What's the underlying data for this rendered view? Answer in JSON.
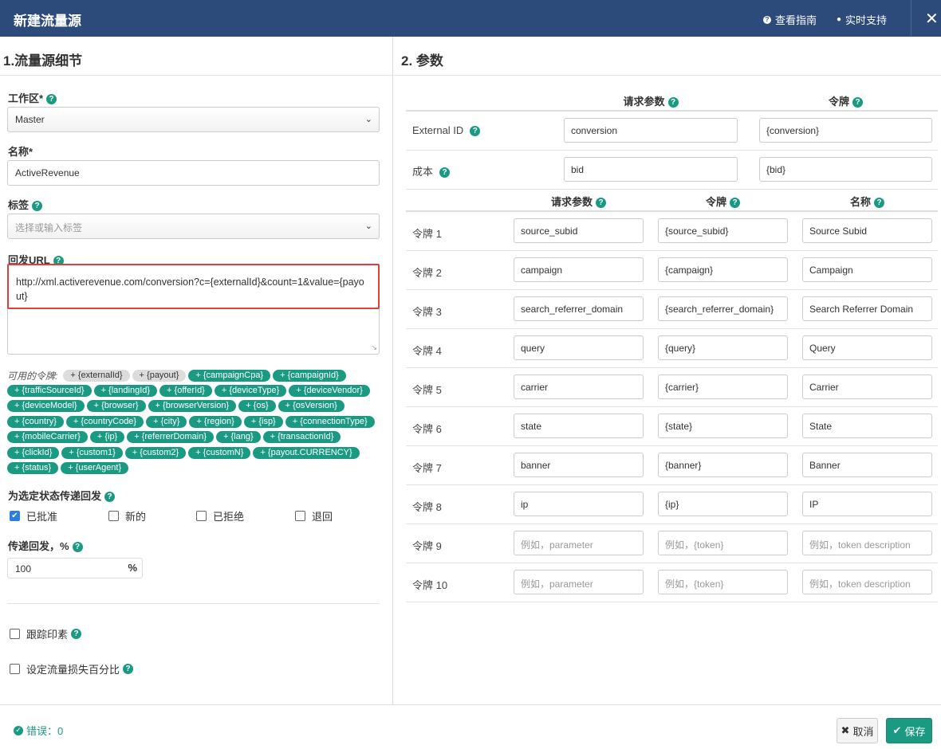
{
  "header": {
    "title": "新建流量源",
    "guide": "查看指南",
    "support": "实时支持",
    "close": "✕"
  },
  "left": {
    "section_title": "1.流量源细节",
    "workspace_label": "工作区*",
    "workspace_value": "Master",
    "name_label": "名称*",
    "name_value": "ActiveRevenue",
    "tags_label": "标签",
    "tags_placeholder": "选择或输入标签",
    "postback_label": "回发URL",
    "postback_value": "http://xml.activerevenue.com/conversion?c={externalId}&count=1&value={payout}",
    "available_label": "可用的令牌:",
    "tokens": [
      {
        "label": "+ {externalId}",
        "used": true
      },
      {
        "label": "+ {payout}",
        "used": true
      },
      {
        "label": "+ {campaignCpa}",
        "used": false
      },
      {
        "label": "+ {campaignId}",
        "used": false
      },
      {
        "label": "+ {trafficSourceId}",
        "used": false
      },
      {
        "label": "+ {landingId}",
        "used": false
      },
      {
        "label": "+ {offerId}",
        "used": false
      },
      {
        "label": "+ {deviceType}",
        "used": false
      },
      {
        "label": "+ {deviceVendor}",
        "used": false
      },
      {
        "label": "+ {deviceModel}",
        "used": false
      },
      {
        "label": "+ {browser}",
        "used": false
      },
      {
        "label": "+ {browserVersion}",
        "used": false
      },
      {
        "label": "+ {os}",
        "used": false
      },
      {
        "label": "+ {osVersion}",
        "used": false
      },
      {
        "label": "+ {country}",
        "used": false
      },
      {
        "label": "+ {countryCode}",
        "used": false
      },
      {
        "label": "+ {city}",
        "used": false
      },
      {
        "label": "+ {region}",
        "used": false
      },
      {
        "label": "+ {isp}",
        "used": false
      },
      {
        "label": "+ {connectionType}",
        "used": false
      },
      {
        "label": "+ {mobileCarrier}",
        "used": false
      },
      {
        "label": "+ {ip}",
        "used": false
      },
      {
        "label": "+ {referrerDomain}",
        "used": false
      },
      {
        "label": "+ {lang}",
        "used": false
      },
      {
        "label": "+ {transactionId}",
        "used": false
      },
      {
        "label": "+ {clickId}",
        "used": false
      },
      {
        "label": "+ {custom1}",
        "used": false
      },
      {
        "label": "+ {custom2}",
        "used": false
      },
      {
        "label": "+ {customN}",
        "used": false
      },
      {
        "label": "+ {payout.CURRENCY}",
        "used": false
      },
      {
        "label": "+ {status}",
        "used": false
      },
      {
        "label": "+ {userAgent}",
        "used": false
      }
    ],
    "status_label": "为选定状态传递回发",
    "statuses": [
      {
        "label": "已批准",
        "checked": true
      },
      {
        "label": "新的",
        "checked": false
      },
      {
        "label": "已拒绝",
        "checked": false
      },
      {
        "label": "退回",
        "checked": false
      }
    ],
    "pass_label": "传递回发，%",
    "pass_value": "100",
    "pass_unit": "%",
    "track_label": "跟踪印素",
    "loss_label": "设定流量损失百分比"
  },
  "right": {
    "section_title": "2. 参数",
    "top_headers": {
      "param": "请求参数",
      "token": "令牌"
    },
    "top_rows": [
      {
        "label": "External ID",
        "param": "conversion",
        "token": "{conversion}"
      },
      {
        "label": "成本",
        "param": "bid",
        "token": "{bid}"
      }
    ],
    "headers": {
      "param": "请求参数",
      "token": "令牌",
      "name": "名称"
    },
    "rows": [
      {
        "label": "令牌 1",
        "param": "source_subid",
        "token": "{source_subid}",
        "name": "Source Subid"
      },
      {
        "label": "令牌 2",
        "param": "campaign",
        "token": "{campaign}",
        "name": "Campaign"
      },
      {
        "label": "令牌 3",
        "param": "search_referrer_domain",
        "token": "{search_referrer_domain}",
        "name": "Search Referrer Domain"
      },
      {
        "label": "令牌 4",
        "param": "query",
        "token": "{query}",
        "name": "Query"
      },
      {
        "label": "令牌 5",
        "param": "carrier",
        "token": "{carrier}",
        "name": "Carrier"
      },
      {
        "label": "令牌 6",
        "param": "state",
        "token": "{state}",
        "name": "State"
      },
      {
        "label": "令牌 7",
        "param": "banner",
        "token": "{banner}",
        "name": "Banner"
      },
      {
        "label": "令牌 8",
        "param": "ip",
        "token": "{ip}",
        "name": "IP"
      },
      {
        "label": "令牌 9",
        "param": "",
        "token": "",
        "name": ""
      },
      {
        "label": "令牌 10",
        "param": "",
        "token": "",
        "name": ""
      }
    ],
    "placeholders": {
      "param": "例如，parameter",
      "token": "例如，{token}",
      "name": "例如，token description"
    }
  },
  "footer": {
    "errors": "错误：0",
    "cancel": "取消",
    "save": "保存"
  },
  "colors": {
    "header": "#2c4b7b",
    "accent": "#1a9a83",
    "highlight": "#e0403a",
    "checkbox": "#2a7de1"
  }
}
